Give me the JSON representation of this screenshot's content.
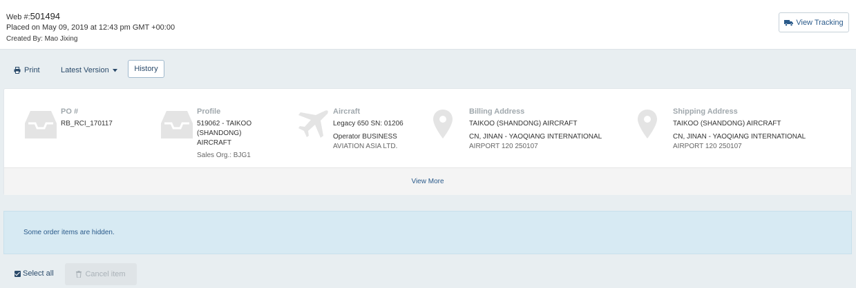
{
  "header": {
    "web_label": "Web #:",
    "web_number": "501494",
    "placed": "Placed on May 09, 2019 at 12:43 pm GMT +00:00",
    "created_by": "Created By: Mao Jixing",
    "view_tracking_label": "View Tracking"
  },
  "toolbar": {
    "print_label": "Print",
    "version_label": "Latest Version",
    "history_label": "History"
  },
  "info": {
    "po": {
      "label": "PO #",
      "value": "RB_RCI_170117"
    },
    "profile": {
      "label": "Profile",
      "line1": "519062 - TAIKOO",
      "line2": "(SHANDONG) AIRCRAFT",
      "sales_org": "Sales Org.: BJG1"
    },
    "aircraft": {
      "label": "Aircraft",
      "line1": "Legacy 650 SN: 01206",
      "line2": "Operator BUSINESS",
      "line3": "AVIATION ASIA LTD."
    },
    "billing": {
      "label": "Billing Address",
      "line1": "TAIKOO (SHANDONG) AIRCRAFT",
      "line2": "CN, JINAN - YAOQIANG INTERNATIONAL",
      "line3": "AIRPORT 120 250107"
    },
    "shipping": {
      "label": "Shipping Address",
      "line1": "TAIKOO (SHANDONG) AIRCRAFT",
      "line2": "CN, JINAN - YAOQIANG INTERNATIONAL",
      "line3": "AIRPORT 120 250107"
    },
    "view_more_label": "View More"
  },
  "alert": {
    "text": "Some order items are hidden."
  },
  "actions": {
    "select_all_label": "Select all",
    "cancel_item_label": "Cancel item"
  },
  "icons": [
    "truck-icon",
    "printer-icon",
    "caret-down-icon",
    "inbox-icon",
    "airplane-icon",
    "map-marker-icon",
    "checkbox-icon",
    "trash-icon"
  ]
}
